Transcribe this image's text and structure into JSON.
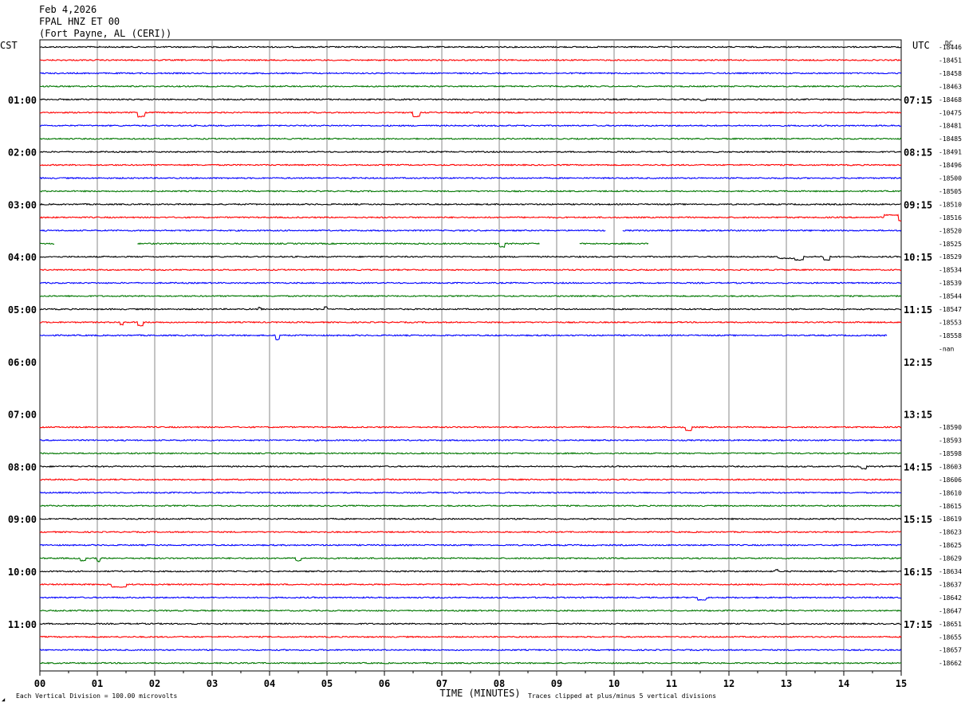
{
  "header": {
    "date": "Feb 4,2026",
    "channel": "FPAL HNZ ET 00",
    "location": "(Fort Payne, AL (CERI))"
  },
  "left_timezone": "CST",
  "right_timezone": "UTC",
  "dc_label": "DC",
  "nan_label": "-nan",
  "footer": {
    "scale_note": "Each Vertical Division =  100.00 microvolts",
    "clip_note": "Traces clipped at plus/minus 5 vertical divisions",
    "logo": "◢"
  },
  "chart_data": {
    "type": "line",
    "title": "FPAL HNZ ET 00",
    "xlabel": "TIME (MINUTES)",
    "ylabel": "",
    "xlim": [
      0,
      15
    ],
    "x_ticks": [
      "00",
      "01",
      "02",
      "03",
      "04",
      "05",
      "06",
      "07",
      "08",
      "09",
      "10",
      "11",
      "12",
      "13",
      "14",
      "15"
    ],
    "grid": true,
    "trace_colors": [
      "#000000",
      "#ff0000",
      "#0000ff",
      "#007700"
    ],
    "left_hour_labels": [
      "01:00",
      "02:00",
      "03:00",
      "04:00",
      "05:00",
      "06:00",
      "07:00",
      "08:00",
      "09:00",
      "10:00",
      "11:00"
    ],
    "right_hour_labels": [
      "07:15",
      "08:15",
      "09:15",
      "10:15",
      "11:15",
      "12:15",
      "13:15",
      "14:15",
      "15:15",
      "16:15",
      "17:15"
    ],
    "traces": [
      {
        "row": 0,
        "dc": "-18446"
      },
      {
        "row": 1,
        "dc": "-18451"
      },
      {
        "row": 2,
        "dc": "-18458"
      },
      {
        "row": 3,
        "dc": "-18463"
      },
      {
        "row": 4,
        "dc": "-18468",
        "events": [
          [
            11.5,
            0.1,
            1
          ]
        ]
      },
      {
        "row": 5,
        "dc": "-10475",
        "events": [
          [
            1.7,
            0.12,
            5
          ],
          [
            6.5,
            0.12,
            5
          ]
        ]
      },
      {
        "row": 6,
        "dc": "-18481"
      },
      {
        "row": 7,
        "dc": "-18485"
      },
      {
        "row": 8,
        "dc": "-18491"
      },
      {
        "row": 9,
        "dc": "-18496"
      },
      {
        "row": 10,
        "dc": "-18500"
      },
      {
        "row": 11,
        "dc": "-18505"
      },
      {
        "row": 12,
        "dc": "-18510"
      },
      {
        "row": 13,
        "dc": "-18516",
        "events": [
          [
            14.7,
            0.3,
            -3
          ],
          [
            14.95,
            0.05,
            4
          ]
        ]
      },
      {
        "row": 14,
        "dc": "-18520",
        "gaps": [
          [
            9.85,
            10.15
          ]
        ]
      },
      {
        "row": 15,
        "dc": "-18525",
        "segments": [
          [
            0,
            0.25
          ],
          [
            1.7,
            8.7
          ],
          [
            9.4,
            10.6
          ]
        ],
        "events": [
          [
            8.0,
            0.1,
            4
          ]
        ]
      },
      {
        "row": 16,
        "dc": "-18529",
        "events": [
          [
            12.85,
            0.3,
            2
          ],
          [
            13.15,
            0.15,
            4
          ],
          [
            13.65,
            0.1,
            4
          ]
        ]
      },
      {
        "row": 17,
        "dc": "-18534"
      },
      {
        "row": 18,
        "dc": "-18539"
      },
      {
        "row": 19,
        "dc": "-18544"
      },
      {
        "row": 20,
        "dc": "-18547",
        "events": [
          [
            4.95,
            0.06,
            -3
          ],
          [
            3.8,
            0.05,
            -2
          ]
        ]
      },
      {
        "row": 21,
        "dc": "-18553",
        "events": [
          [
            1.7,
            0.1,
            4
          ],
          [
            1.4,
            0.05,
            3
          ]
        ]
      },
      {
        "row": 22,
        "dc": "-18558",
        "segments": [
          [
            0,
            14.75
          ]
        ],
        "events": [
          [
            4.1,
            0.08,
            5
          ]
        ]
      },
      {
        "row": 23,
        "dc": "-nan",
        "segments": []
      },
      {
        "row": 24,
        "dc": "",
        "segments": []
      },
      {
        "row": 25,
        "dc": "",
        "segments": []
      },
      {
        "row": 26,
        "dc": "",
        "segments": []
      },
      {
        "row": 27,
        "dc": "",
        "segments": []
      },
      {
        "row": 28,
        "dc": "",
        "segments": []
      },
      {
        "row": 29,
        "dc": "-18590",
        "events": [
          [
            11.25,
            0.1,
            4
          ]
        ]
      },
      {
        "row": 30,
        "dc": "-18593"
      },
      {
        "row": 31,
        "dc": "-18598"
      },
      {
        "row": 32,
        "dc": "-18603",
        "events": [
          [
            14.3,
            0.1,
            3
          ]
        ]
      },
      {
        "row": 33,
        "dc": "-18606"
      },
      {
        "row": 34,
        "dc": "-18610"
      },
      {
        "row": 35,
        "dc": "-18615"
      },
      {
        "row": 36,
        "dc": "-18619"
      },
      {
        "row": 37,
        "dc": "-18623"
      },
      {
        "row": 38,
        "dc": "-18625"
      },
      {
        "row": 39,
        "dc": "-18629",
        "events": [
          [
            0.7,
            0.1,
            3
          ],
          [
            1.0,
            0.05,
            4
          ],
          [
            4.45,
            0.1,
            3
          ]
        ]
      },
      {
        "row": 40,
        "dc": "-18634",
        "events": [
          [
            12.8,
            0.05,
            -2
          ]
        ]
      },
      {
        "row": 41,
        "dc": "-18637",
        "events": [
          [
            1.25,
            0.25,
            3
          ]
        ]
      },
      {
        "row": 42,
        "dc": "-18642",
        "events": [
          [
            11.45,
            0.15,
            3
          ]
        ]
      },
      {
        "row": 43,
        "dc": "-18647"
      },
      {
        "row": 44,
        "dc": "-18651"
      },
      {
        "row": 45,
        "dc": "-18655"
      },
      {
        "row": 46,
        "dc": "-18657"
      },
      {
        "row": 47,
        "dc": "-18662"
      }
    ]
  }
}
